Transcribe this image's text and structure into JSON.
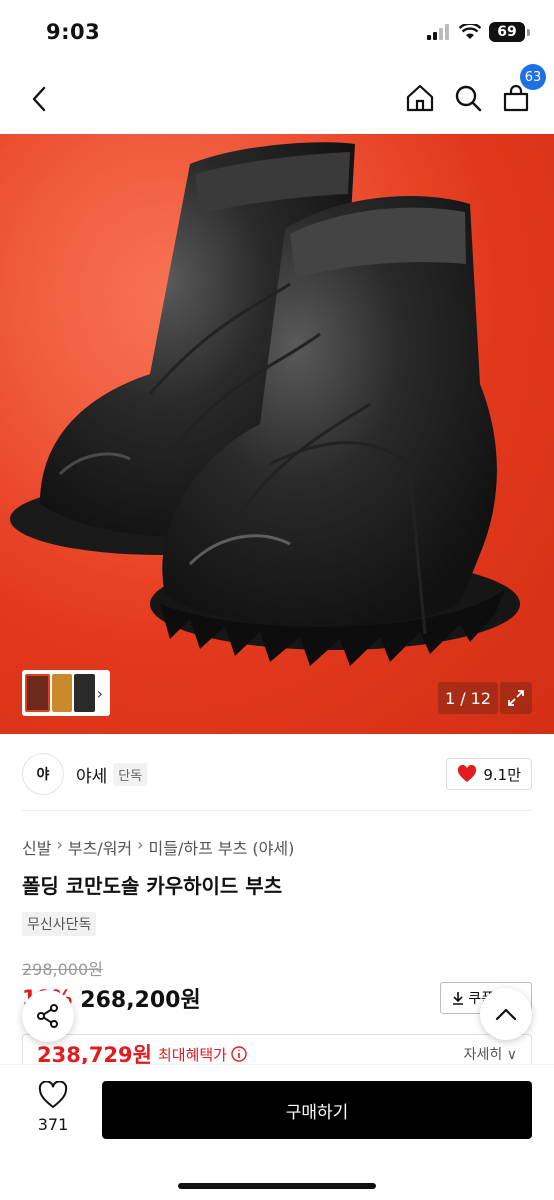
{
  "status_bar": {
    "time": "9:03",
    "battery": "69"
  },
  "nav": {
    "back_icon": "chevron-left-icon",
    "home_icon": "home-icon",
    "search_icon": "search-icon",
    "cart_icon": "cart-icon",
    "cart_count": "63"
  },
  "gallery": {
    "counter": "1 / 12",
    "thumb_arrow": "›",
    "expand_icon": "expand-icon"
  },
  "brand": {
    "logo_text": "야",
    "name": "야세",
    "tag": "단독",
    "likes": "9.1만"
  },
  "breadcrumb": [
    {
      "label": "신발"
    },
    {
      "label": "부츠/워커"
    },
    {
      "label": "미들/하프 부츠 (야세)"
    }
  ],
  "product": {
    "title": "폴딩 코만도솔 카우하이드 부츠",
    "exclusive_tag": "무신사단독",
    "original_price": "298,000원",
    "discount": "10%",
    "sale_price": "268,200원",
    "coupon_label": "쿠폰받기"
  },
  "benefit": {
    "price": "238,729원",
    "label": "최대혜택가",
    "more": "자세히 ∨"
  },
  "bottom": {
    "wish_count": "371",
    "buy_label": "구매하기"
  },
  "colors": {
    "accent_red": "#e11d1d",
    "badge_blue": "#1f6fe5",
    "hero_background": "#e63c20"
  }
}
